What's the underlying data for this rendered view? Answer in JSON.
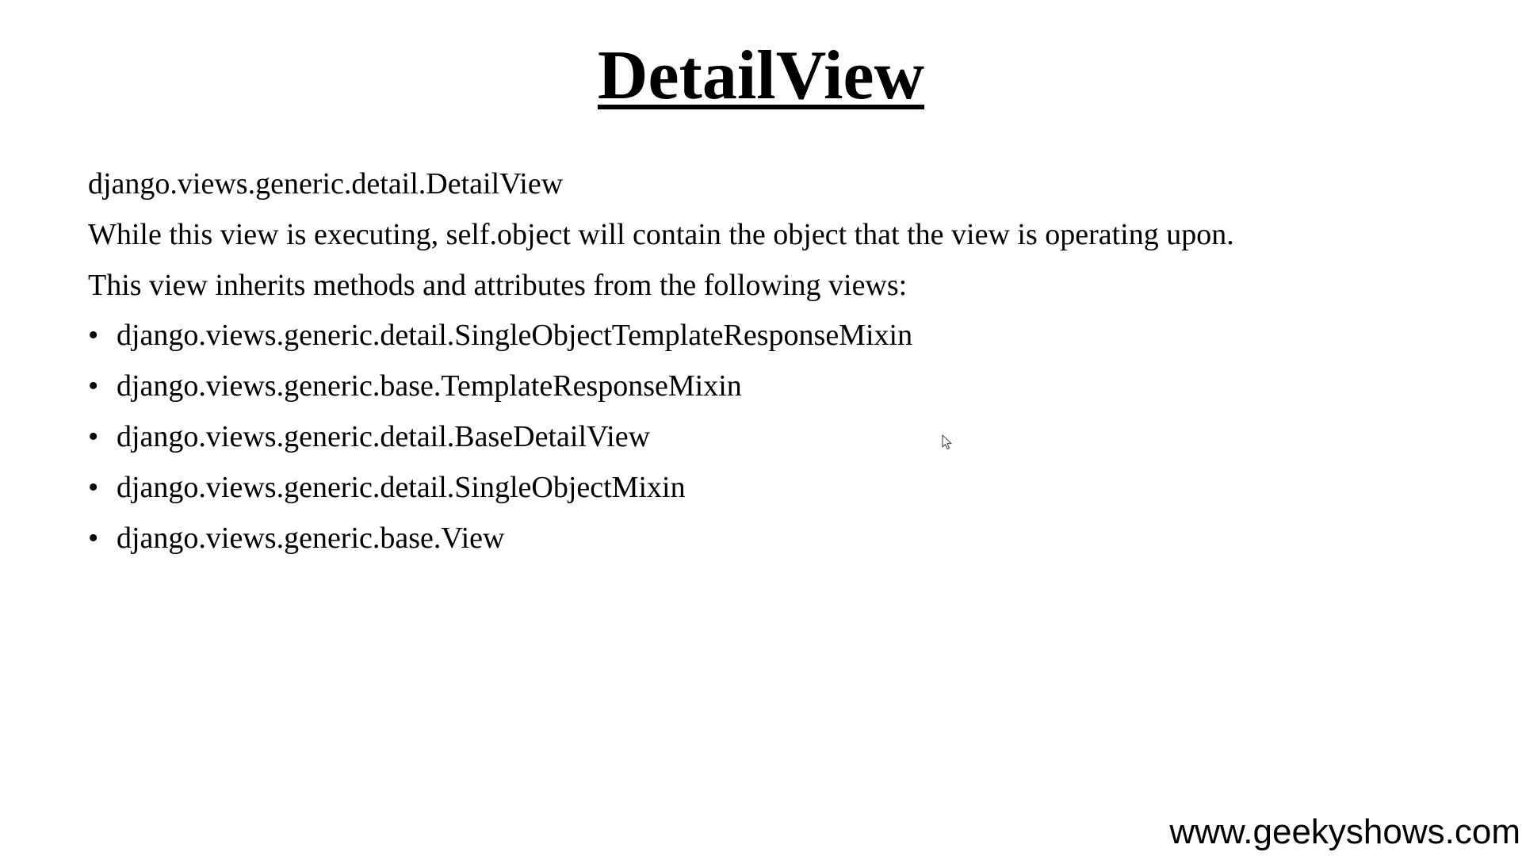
{
  "slide": {
    "title": "DetailView",
    "class_path": "django.views.generic.detail.DetailView",
    "description": "While this view is executing, self.object will contain the object that the view is operating upon.",
    "inherit_intro": "This view inherits methods and attributes from the following views:",
    "bullet_symbol": "•",
    "ancestors": [
      "django.views.generic.detail.SingleObjectTemplateResponseMixin",
      "django.views.generic.base.TemplateResponseMixin",
      "django.views.generic.detail.BaseDetailView",
      "django.views.generic.detail.SingleObjectMixin",
      "django.views.generic.base.View"
    ]
  },
  "footer": {
    "website": "www.geekyshows.com"
  },
  "cursor": {
    "icon": "mouse-pointer-icon"
  }
}
